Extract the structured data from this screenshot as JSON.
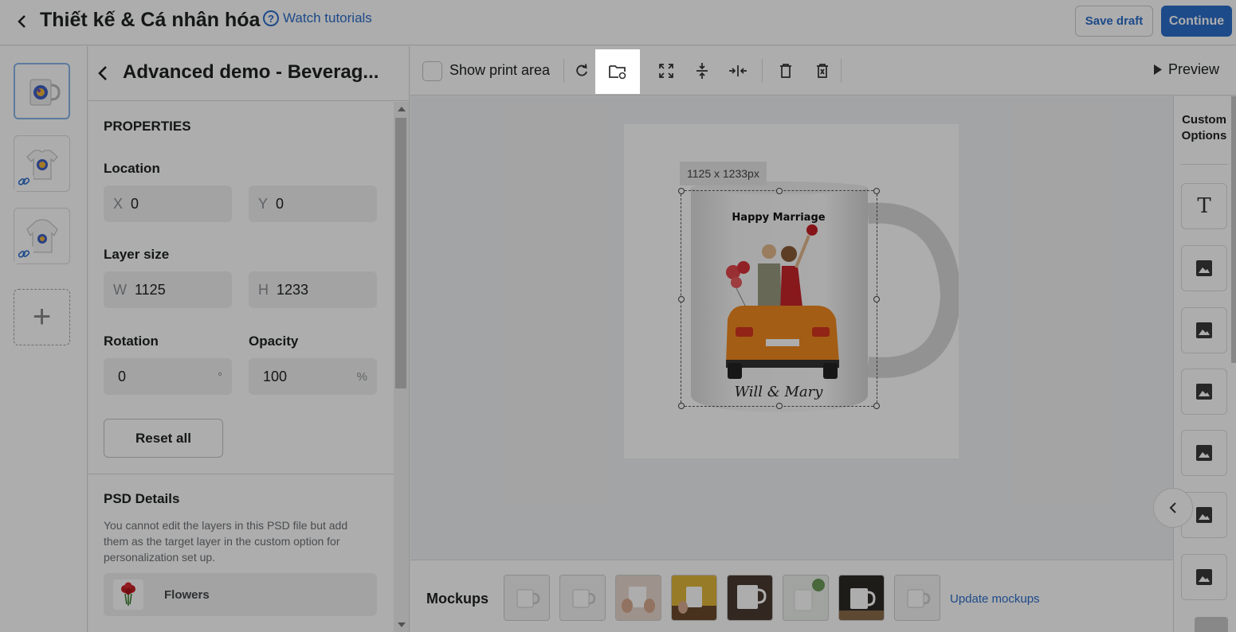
{
  "header": {
    "title": "Thiết kế & Cá nhân hóa",
    "tutorials_label": "Watch tutorials",
    "save_draft_label": "Save draft",
    "continue_label": "Continue"
  },
  "panel": {
    "title": "Advanced demo - Beverag...",
    "properties_heading": "PROPERTIES",
    "location_label": "Location",
    "x_prefix": "X",
    "x_value": "0",
    "y_prefix": "Y",
    "y_value": "0",
    "layer_size_label": "Layer size",
    "w_prefix": "W",
    "w_value": "1125",
    "h_prefix": "H",
    "h_value": "1233",
    "rotation_label": "Rotation",
    "rotation_value": "0",
    "rotation_unit": "°",
    "opacity_label": "Opacity",
    "opacity_value": "100",
    "opacity_unit": "%",
    "reset_label": "Reset all",
    "psd_heading": "PSD Details",
    "psd_description": "You cannot edit the layers in this PSD file but add them as the target layer in the custom option for personalization set up.",
    "layer_name": "Flowers"
  },
  "toolbar": {
    "show_print_area_label": "Show print area",
    "preview_label": "Preview"
  },
  "canvas": {
    "dimension_badge": "1125 x 1233px",
    "mug_text_top": "Happy Marriage",
    "mug_text_bottom": "Will & Mary"
  },
  "custom_options": {
    "title": "Custom Options",
    "text_icon_glyph": "T"
  },
  "mockups": {
    "label": "Mockups",
    "update_label": "Update mockups"
  },
  "colors": {
    "accent": "#2c6ecb",
    "overlay": "rgba(0,0,0,0.32)"
  },
  "icons": [
    "back-arrow-icon",
    "question-icon",
    "link-icon",
    "plus-icon",
    "refresh-icon",
    "folder-replace-icon",
    "expand-icon",
    "align-vertical-center-icon",
    "align-horizontal-center-icon",
    "trash-icon",
    "delete-all-icon",
    "play-icon",
    "text-icon",
    "image-icon",
    "chevron-left-icon"
  ]
}
